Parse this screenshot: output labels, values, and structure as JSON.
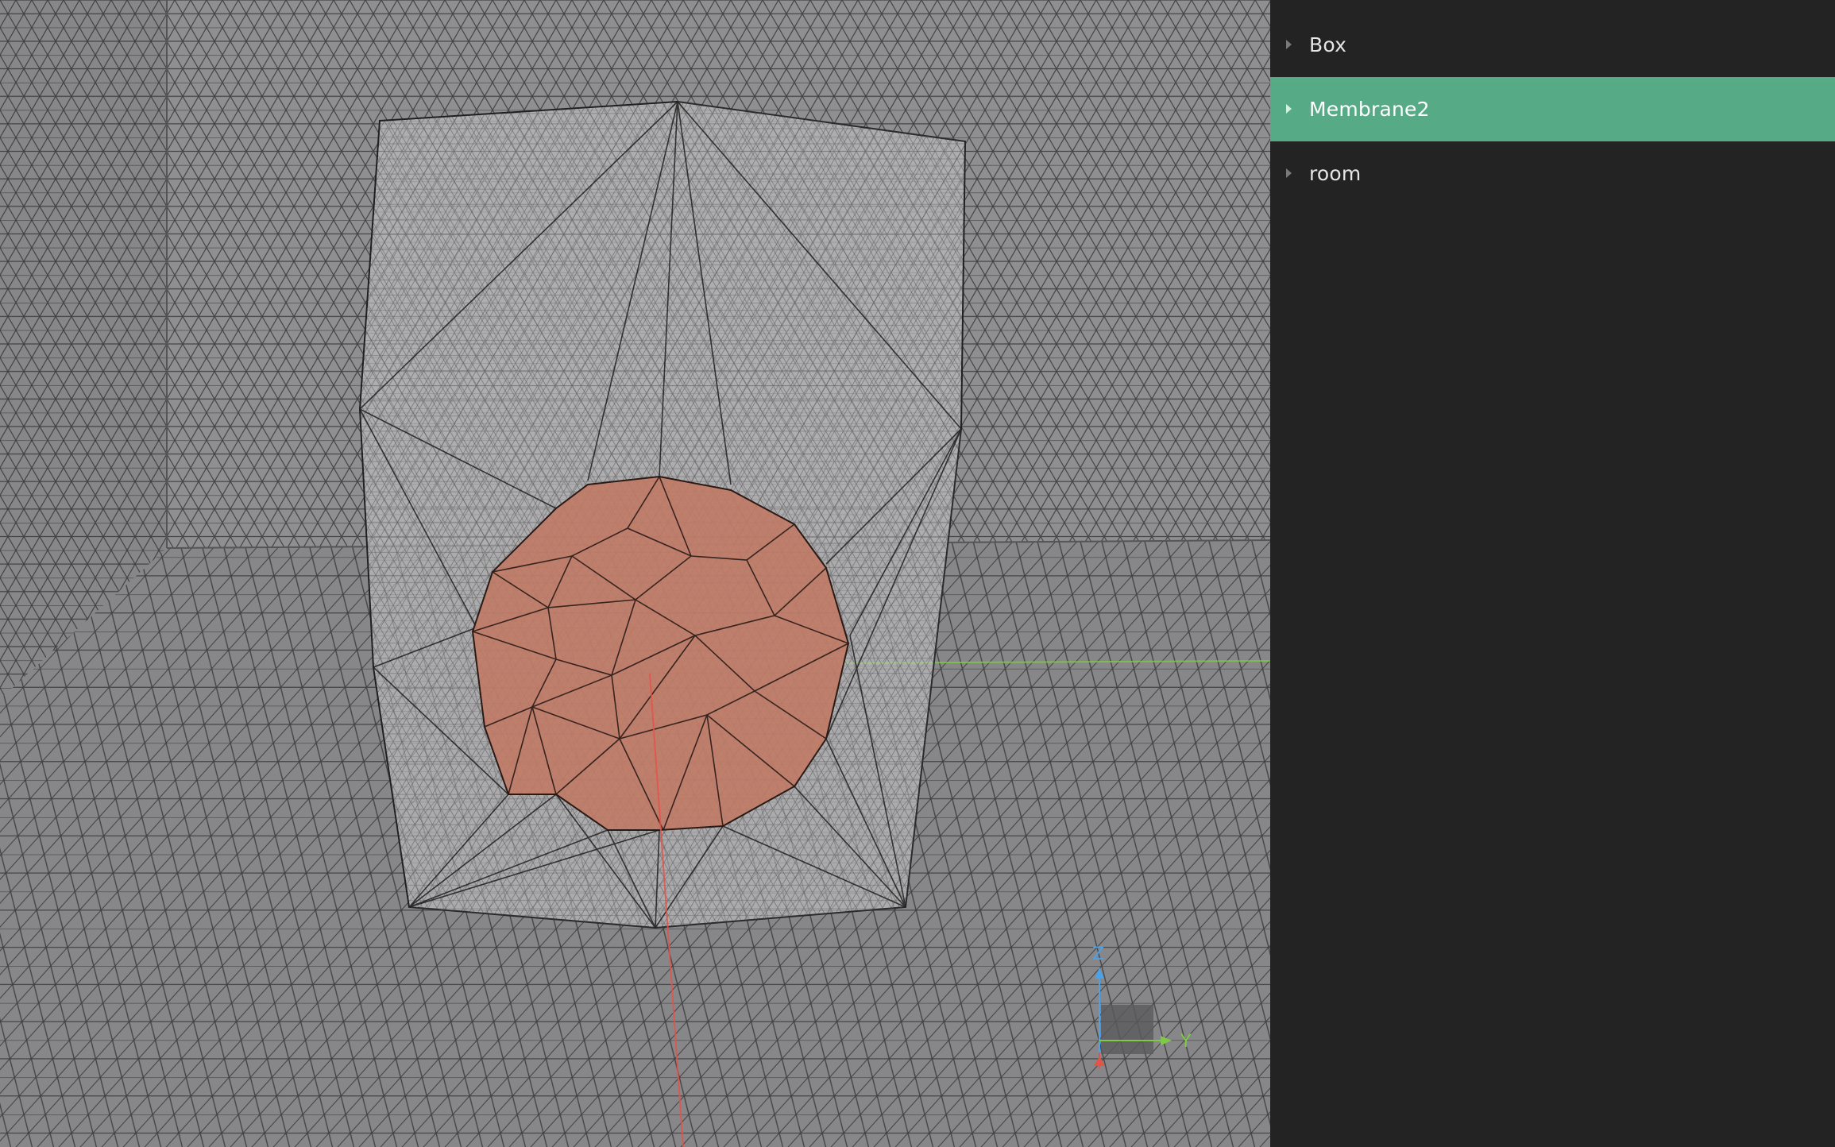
{
  "outliner": {
    "items": [
      {
        "label": "Box",
        "selected": false
      },
      {
        "label": "Membrane2",
        "selected": true
      },
      {
        "label": "room",
        "selected": false
      }
    ],
    "selected_color": "#56aa86"
  },
  "viewport": {
    "background_color": "#8b8b8d",
    "sphere_color": "#c07a66",
    "axis_gizmo": {
      "z_label": "Z",
      "y_label": "Y",
      "z_color": "#4aa3ea",
      "y_color": "#7ecb43",
      "x_color": "#e4534a"
    }
  }
}
